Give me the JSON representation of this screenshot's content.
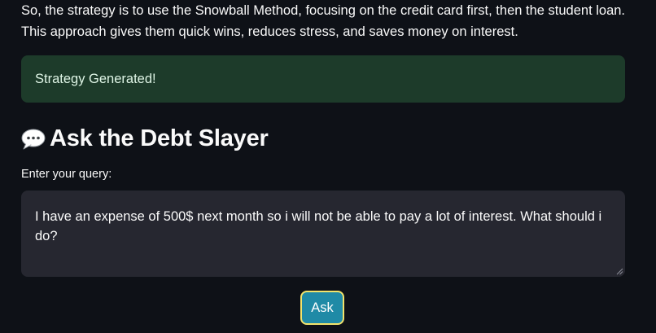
{
  "intro": {
    "line1": "So, the strategy is to use the Snowball Method, focusing on the credit card first, then the student loan.",
    "line2": "This approach gives them quick wins, reduces stress, and saves money on interest."
  },
  "alert": {
    "text": "Strategy Generated!",
    "color": "#1d3b2a"
  },
  "section": {
    "title": "Ask the Debt Slayer",
    "icon": "speech-bubble-icon"
  },
  "query": {
    "label": "Enter your query:",
    "value": "I have an expense of 500$ next month so i will not be able to pay a lot of interest. What should i do?"
  },
  "ask_button": {
    "label": "Ask",
    "color": "#1f8aa6",
    "border_color": "#f2e36b"
  },
  "theme": {
    "background": "#0e1117",
    "input_background": "#262730"
  }
}
